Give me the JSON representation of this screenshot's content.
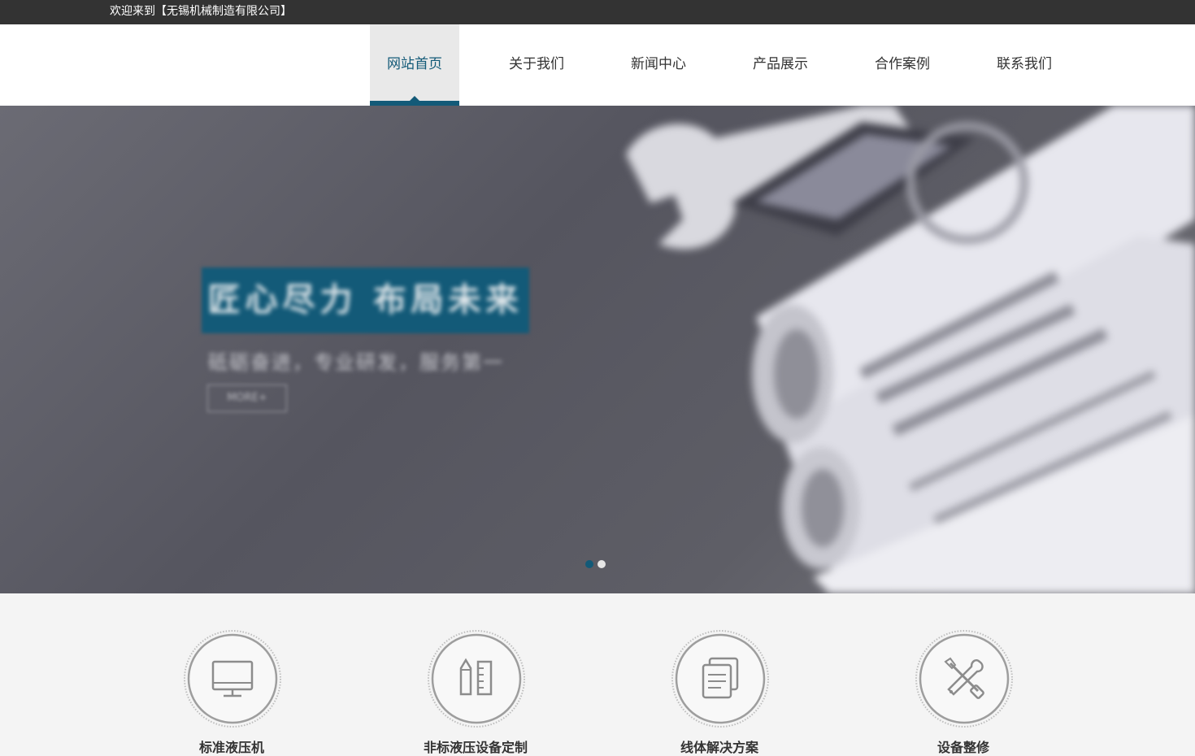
{
  "topbar": {
    "welcome": "欢迎来到【无锡机械制造有限公司】"
  },
  "nav": {
    "items": [
      {
        "label": "网站首页",
        "active": true
      },
      {
        "label": "关于我们"
      },
      {
        "label": "新闻中心"
      },
      {
        "label": "产品展示"
      },
      {
        "label": "合作案例"
      },
      {
        "label": "联系我们"
      }
    ]
  },
  "banner": {
    "headline": "匠心尽力 布局未来",
    "subline": "砥砺奋进，专业研发，服务第一",
    "more_label": "MORE+",
    "active_slide": 1,
    "slide_count": 2
  },
  "services": [
    {
      "title": "标准液压机",
      "icon": "monitor-icon"
    },
    {
      "title": "非标液压设备定制",
      "icon": "pencil-ruler-icon"
    },
    {
      "title": "线体解决方案",
      "icon": "documents-icon"
    },
    {
      "title": "设备整修",
      "icon": "tools-icon"
    }
  ],
  "colors": {
    "accent": "#135a78",
    "topbar": "#333333"
  }
}
